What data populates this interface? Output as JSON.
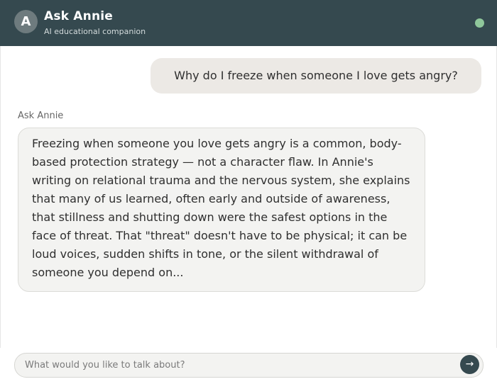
{
  "header": {
    "avatar_letter": "A",
    "title": "Ask Annie",
    "subtitle": "AI educational companion",
    "status_color": "#8fc79b"
  },
  "conversation": {
    "user_message": "Why do I freeze when someone I love gets angry?",
    "assistant_name": "Ask Annie",
    "assistant_message": "Freezing when someone you love gets angry is a common, body-based protection strategy — not a character flaw. In Annie's writing on relational trauma and the nervous system, she explains that many of us learned, often early and outside of awareness, that stillness and shutting down were the safest options in the face of threat. That \"threat\" doesn't have to be physical; it can be loud voices, sudden shifts in tone, or the silent withdrawal of someone you depend on..."
  },
  "composer": {
    "placeholder": "What would you like to talk about?",
    "value": "",
    "send_icon": "arrow-right-icon",
    "send_glyph": "→"
  },
  "colors": {
    "header_bg": "#35494f",
    "user_bubble_bg": "#ece9e5",
    "assistant_bubble_bg": "#f3f3f1"
  }
}
